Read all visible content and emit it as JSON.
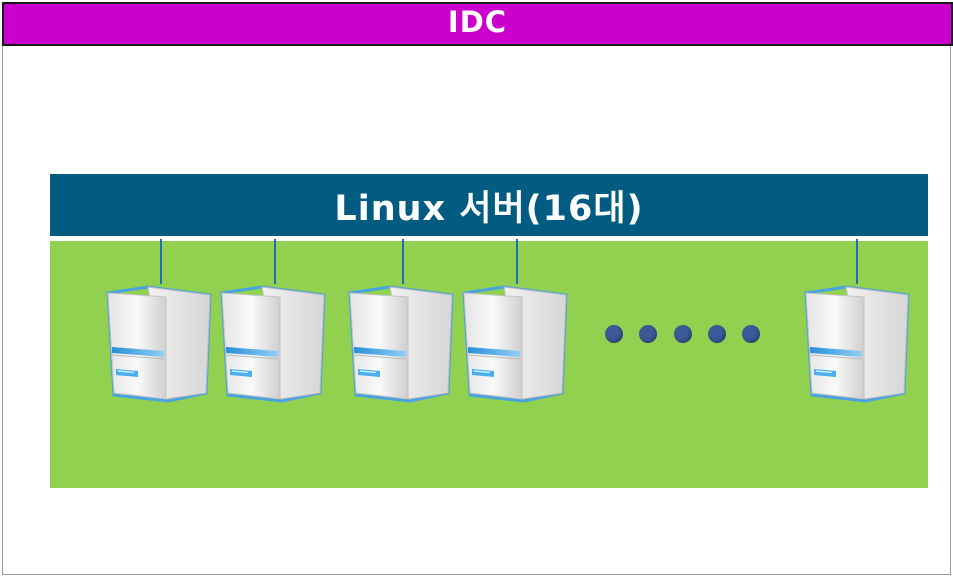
{
  "header": {
    "title": "IDC"
  },
  "server_group": {
    "title": "Linux 서버(16대)",
    "icons": [
      "server-icon",
      "server-icon",
      "server-icon",
      "server-icon",
      "server-icon"
    ],
    "ellipsis_icon": "ellipsis-dots-icon"
  },
  "colors": {
    "header_bg": "#cc00cc",
    "group_title_bg": "#025b80",
    "group_panel_bg": "#92d050",
    "connector": "#1f6fb8",
    "dots": "#3c5a9a"
  }
}
